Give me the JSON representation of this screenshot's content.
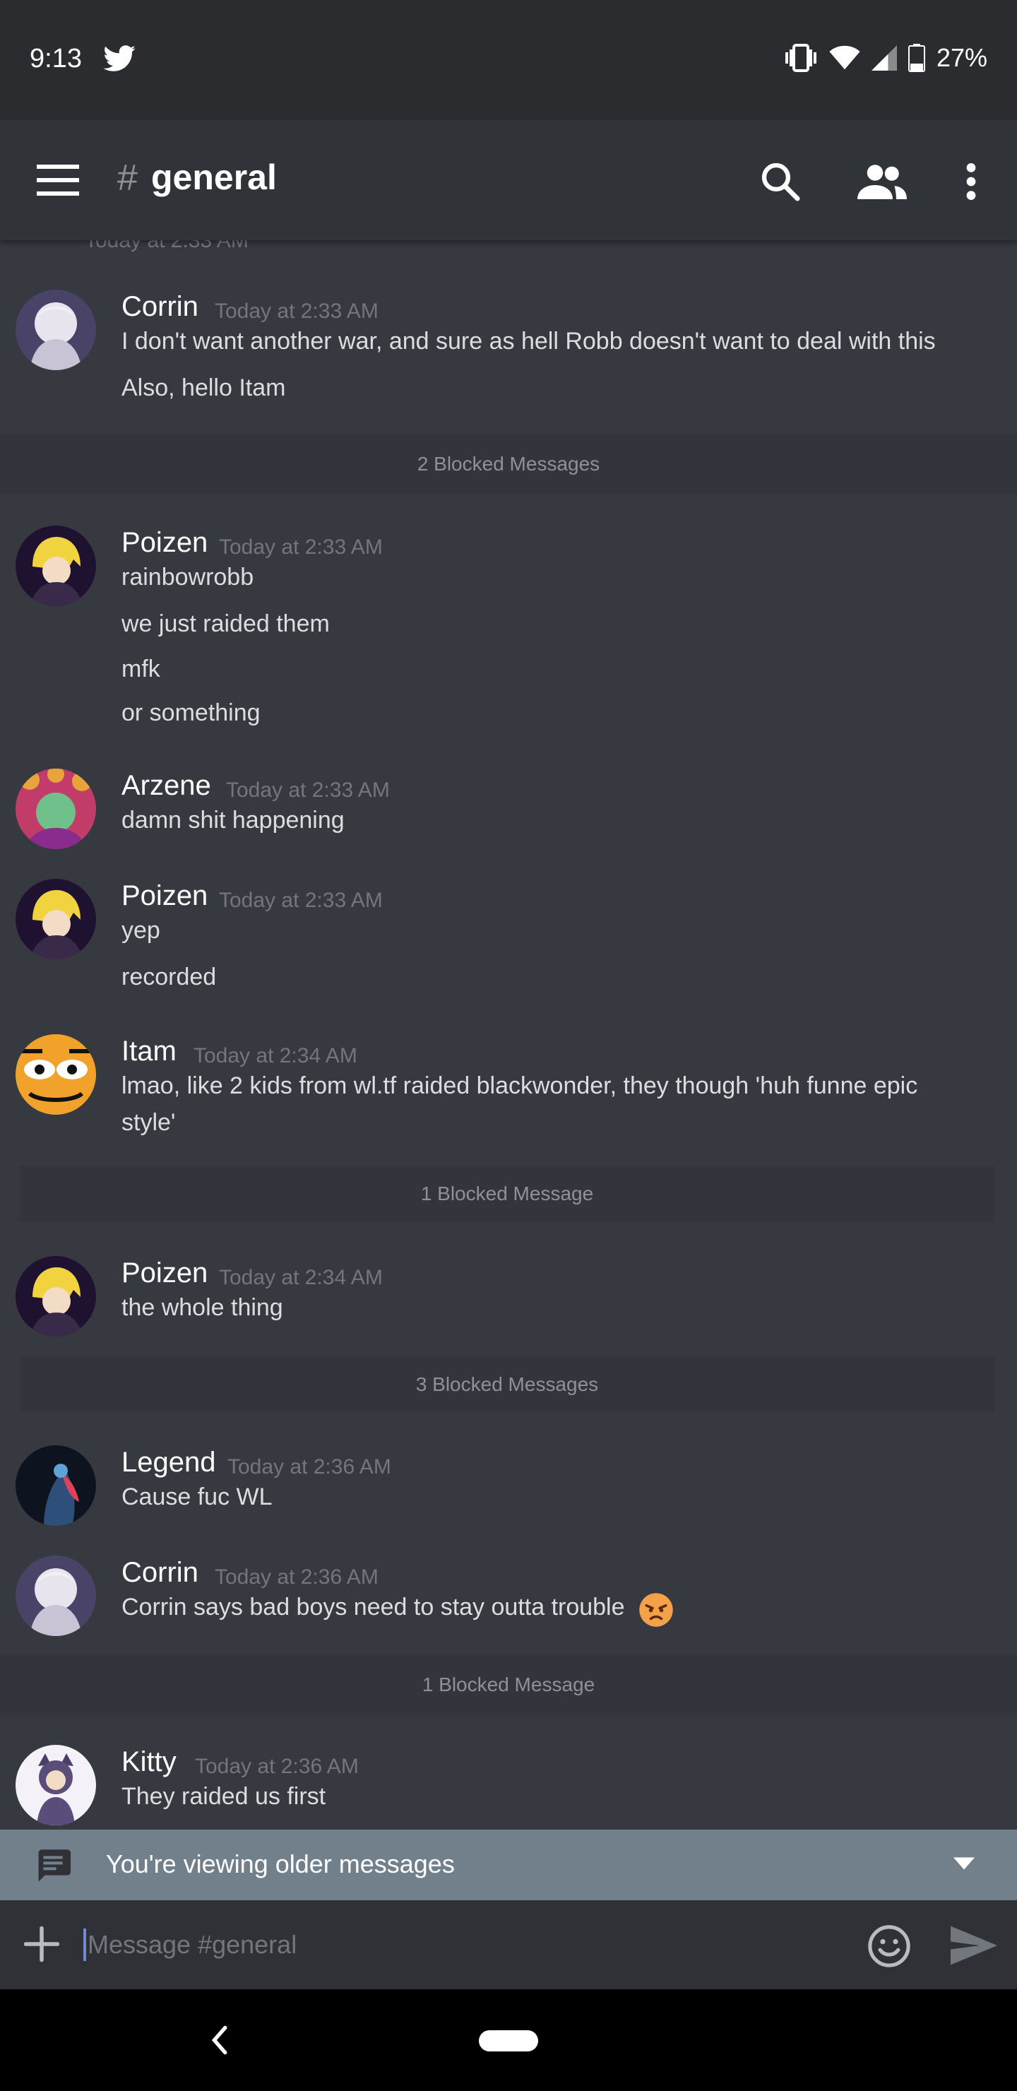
{
  "status_bar": {
    "time": "9:13",
    "battery": "27%"
  },
  "app_bar": {
    "hash": "#",
    "channel": "general"
  },
  "partial_timestamp": "Today at 2:33 AM",
  "messages": [
    {
      "user": "Corrin",
      "time": "Today at 2:33 AM",
      "lines": [
        "I don't want another war, and sure as hell Robb doesn't want to deal with this",
        "Also, hello Itam"
      ]
    },
    {
      "user": "Poizen",
      "time": "Today at 2:33 AM",
      "lines": [
        "rainbowrobb",
        "we just raided them",
        "mfk",
        "or something"
      ]
    },
    {
      "user": "Arzene",
      "time": "Today at 2:33 AM",
      "lines": [
        "damn shit happening"
      ]
    },
    {
      "user": "Poizen",
      "time": "Today at 2:33 AM",
      "lines": [
        "yep",
        "recorded"
      ]
    },
    {
      "user": "Itam",
      "time": "Today at 2:34 AM",
      "lines": [
        "lmao, like 2 kids from wl.tf raided blackwonder, they though 'huh funne epic",
        "style'"
      ]
    },
    {
      "user": "Poizen",
      "time": "Today at 2:34 AM",
      "lines": [
        "the whole thing"
      ]
    },
    {
      "user": "Legend",
      "time": "Today at 2:36 AM",
      "lines": [
        "Cause fuc WL"
      ]
    },
    {
      "user": "Corrin",
      "time": "Today at 2:36 AM",
      "lines": [
        "Corrin says bad boys need to stay outta trouble"
      ]
    },
    {
      "user": "Kitty",
      "time": "Today at 2:36 AM",
      "lines": [
        "They raided us first"
      ]
    }
  ],
  "blocked": [
    "2 Blocked Messages",
    "1 Blocked Message",
    "3 Blocked Messages",
    "1 Blocked Message"
  ],
  "older_bar": {
    "text": "You're viewing older messages"
  },
  "composer": {
    "placeholder": "Message #general"
  },
  "icons": {
    "status": [
      "twitter-icon",
      "vibrate-icon",
      "wifi-icon",
      "signal-icon",
      "battery-icon"
    ],
    "app_bar": [
      "menu-icon",
      "search-icon",
      "members-icon",
      "more-vertical-icon"
    ],
    "composer": [
      "plus-icon",
      "emoji-icon",
      "send-icon"
    ]
  },
  "colors": {
    "background": "#36393f",
    "app_bar": "#303338",
    "older_bar": "#72808c",
    "accent": "#7289da"
  }
}
